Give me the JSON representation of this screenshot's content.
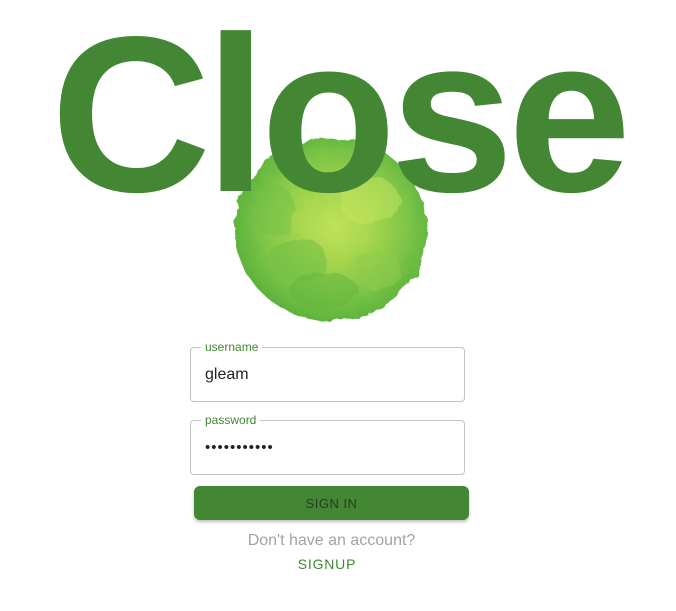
{
  "header": {
    "title": "Close"
  },
  "brand": {
    "accent_color": "#438634",
    "logo": "green-watercolor-circle"
  },
  "login_form": {
    "username": {
      "label": "username",
      "value": "gleam"
    },
    "password": {
      "label": "password",
      "value": "•••••••••••"
    },
    "signin_label": "SIGN IN"
  },
  "footer": {
    "prompt": "Don't have an account?",
    "signup_label": "SIGNUP"
  }
}
